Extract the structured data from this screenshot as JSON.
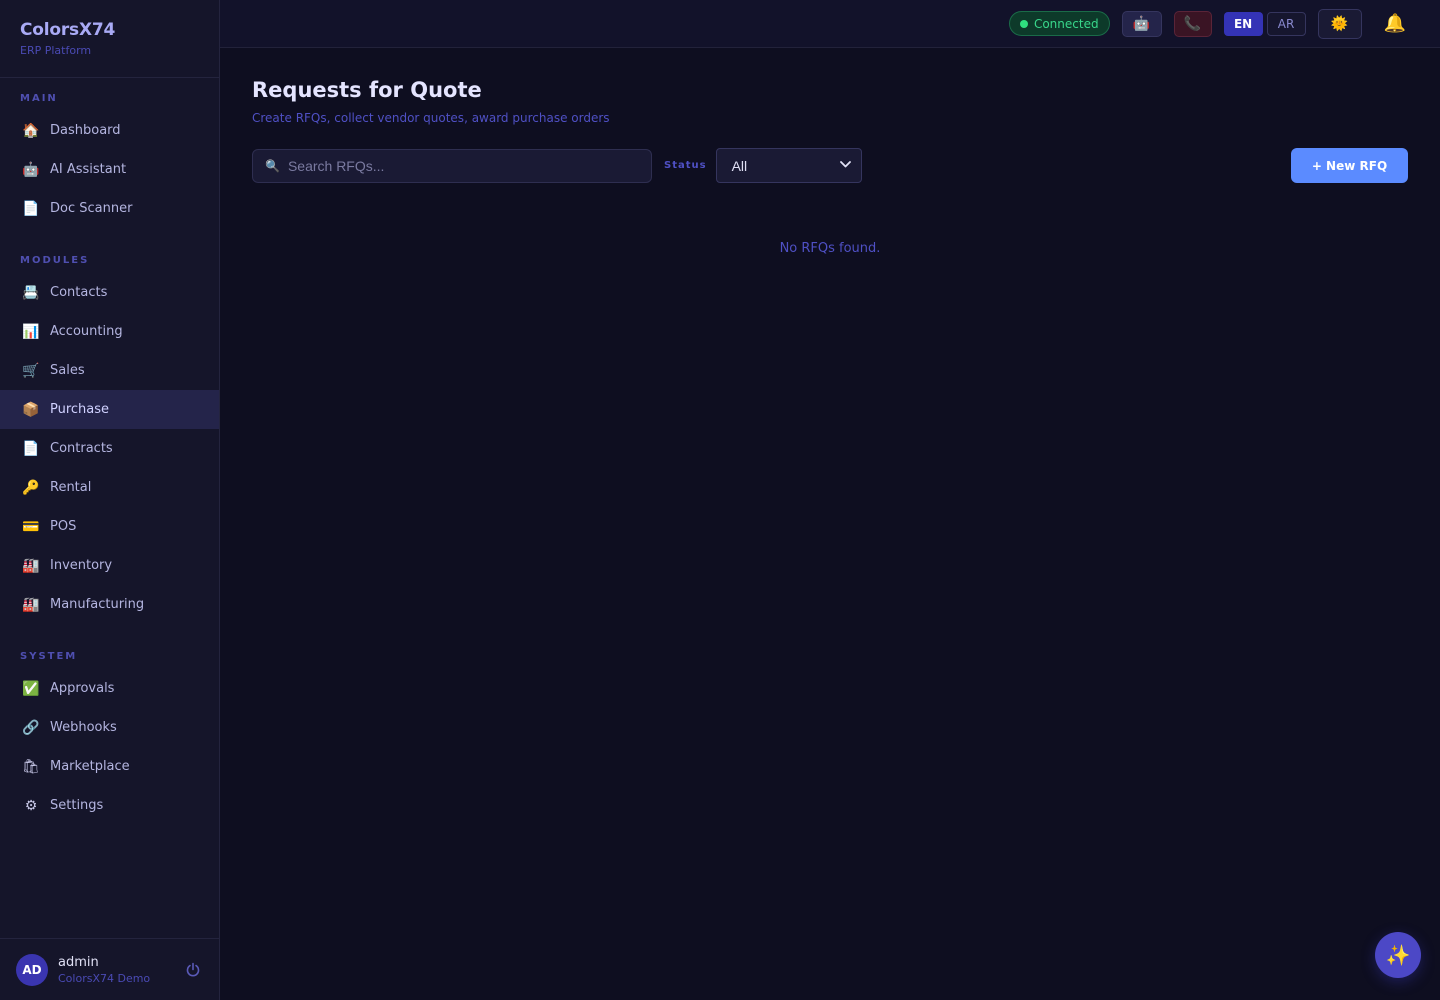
{
  "brand": {
    "title": "ColorsX74",
    "subtitle": "ERP Platform"
  },
  "sidebar": {
    "sections": [
      {
        "label": "MAIN",
        "items": [
          {
            "label": "Dashboard",
            "icon": "🏠",
            "icon_name": "house-icon"
          },
          {
            "label": "AI Assistant",
            "icon": "🤖",
            "icon_name": "robot-icon"
          },
          {
            "label": "Doc Scanner",
            "icon": "📄",
            "icon_name": "document-icon"
          }
        ]
      },
      {
        "label": "MODULES",
        "items": [
          {
            "label": "Contacts",
            "icon": "📇",
            "icon_name": "card-index-icon"
          },
          {
            "label": "Accounting",
            "icon": "📊",
            "icon_name": "bar-chart-icon"
          },
          {
            "label": "Sales",
            "icon": "🛒",
            "icon_name": "cart-icon"
          },
          {
            "label": "Purchase",
            "icon": "📦",
            "icon_name": "package-icon",
            "active": true
          },
          {
            "label": "Contracts",
            "icon": "📄",
            "icon_name": "document-icon"
          },
          {
            "label": "Rental",
            "icon": "🔑",
            "icon_name": "key-icon"
          },
          {
            "label": "POS",
            "icon": "💳",
            "icon_name": "credit-card-icon"
          },
          {
            "label": "Inventory",
            "icon": "🏭",
            "icon_name": "factory-icon"
          },
          {
            "label": "Manufacturing",
            "icon": "🏭",
            "icon_name": "factory-icon"
          }
        ]
      },
      {
        "label": "SYSTEM",
        "items": [
          {
            "label": "Approvals",
            "icon": "✅",
            "icon_name": "check-box-icon"
          },
          {
            "label": "Webhooks",
            "icon": "🔗",
            "icon_name": "link-icon"
          },
          {
            "label": "Marketplace",
            "icon": "🛍",
            "icon_name": "shopping-bags-icon"
          },
          {
            "label": "Settings",
            "icon": "⚙",
            "icon_name": "gear-icon"
          }
        ]
      }
    ]
  },
  "user": {
    "initials": "AD",
    "name": "admin",
    "org": "ColorsX74 Demo"
  },
  "topbar": {
    "status": "Connected",
    "lang_en": "EN",
    "lang_ar": "AR"
  },
  "page": {
    "title": "Requests for Quote",
    "subtitle": "Create RFQs, collect vendor quotes, award purchase orders",
    "search_placeholder": "Search RFQs...",
    "status_label": "Status",
    "status_value": "All",
    "new_button": "+ New RFQ",
    "empty_text": "No RFQs found."
  }
}
